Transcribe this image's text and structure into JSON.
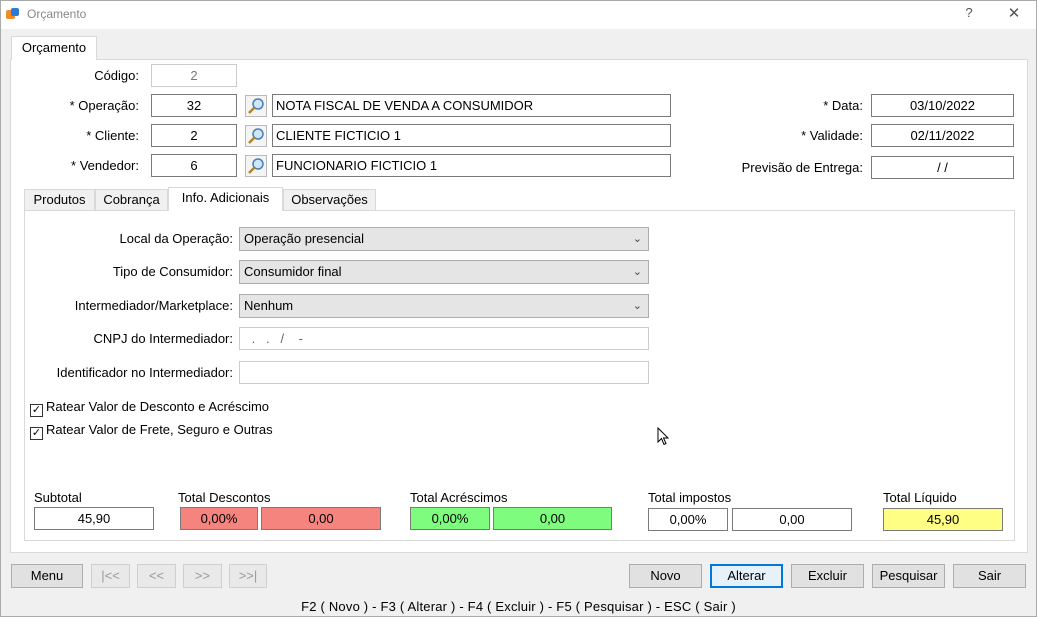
{
  "window": {
    "title": "Orçamento",
    "help": "?",
    "close": "✕",
    "colors": {
      "icon_orange": "#f28c28",
      "icon_blue": "#2a7ad6"
    }
  },
  "main_tab": "Orçamento",
  "header": {
    "codigo": {
      "label": "Código:",
      "value": "2"
    },
    "operacao": {
      "label": "* Operação:",
      "code": "32",
      "desc": "NOTA FISCAL DE VENDA A CONSUMIDOR"
    },
    "cliente": {
      "label": "* Cliente:",
      "code": "2",
      "desc": "CLIENTE FICTICIO 1"
    },
    "vendedor": {
      "label": "* Vendedor:",
      "code": "6",
      "desc": "FUNCIONARIO FICTICIO 1"
    },
    "data": {
      "label": "* Data:",
      "value": "03/10/2022"
    },
    "validade": {
      "label": "* Validade:",
      "value": "02/11/2022"
    },
    "previsao": {
      "label": "Previsão de Entrega:",
      "value": "/  /"
    }
  },
  "tabs": [
    "Produtos",
    "Cobrança",
    "Info. Adicionais",
    "Observações"
  ],
  "info": {
    "local": {
      "label": "Local da Operação:",
      "value": "Operação presencial"
    },
    "tipo": {
      "label": "Tipo de Consumidor:",
      "value": "Consumidor final"
    },
    "intermediador": {
      "label": "Intermediador/Marketplace:",
      "value": "Nenhum"
    },
    "cnpj": {
      "label": "CNPJ do Intermediador:",
      "placeholder": " .   .   /    -"
    },
    "identificador": {
      "label": "Identificador no Intermediador:",
      "value": ""
    },
    "ratear_desconto": {
      "label": "Ratear Valor de Desconto e Acréscimo",
      "checked": true
    },
    "ratear_frete": {
      "label": "Ratear Valor de Frete, Seguro e Outras",
      "checked": true
    }
  },
  "totals": {
    "subtotal": {
      "label": "Subtotal",
      "value": "45,90"
    },
    "descontos": {
      "label": "Total Descontos",
      "pct": "0,00%",
      "value": "0,00"
    },
    "acrescimos": {
      "label": "Total Acréscimos",
      "pct": "0,00%",
      "value": "0,00"
    },
    "impostos": {
      "label": "Total impostos",
      "pct": "0,00%",
      "value": "0,00"
    },
    "liquido": {
      "label": "Total Líquido",
      "value": "45,90"
    }
  },
  "buttons": {
    "menu": "Menu",
    "first": "|<<",
    "prev": "<<",
    "next": ">>",
    "last": ">>|",
    "novo": "Novo",
    "alterar": "Alterar",
    "excluir": "Excluir",
    "pesquisar": "Pesquisar",
    "sair": "Sair"
  },
  "shortcuts": "F2 ( Novo )  -  F3 ( Alterar )  -  F4 ( Excluir )  -  F5 ( Pesquisar )  -  ESC ( Sair )"
}
